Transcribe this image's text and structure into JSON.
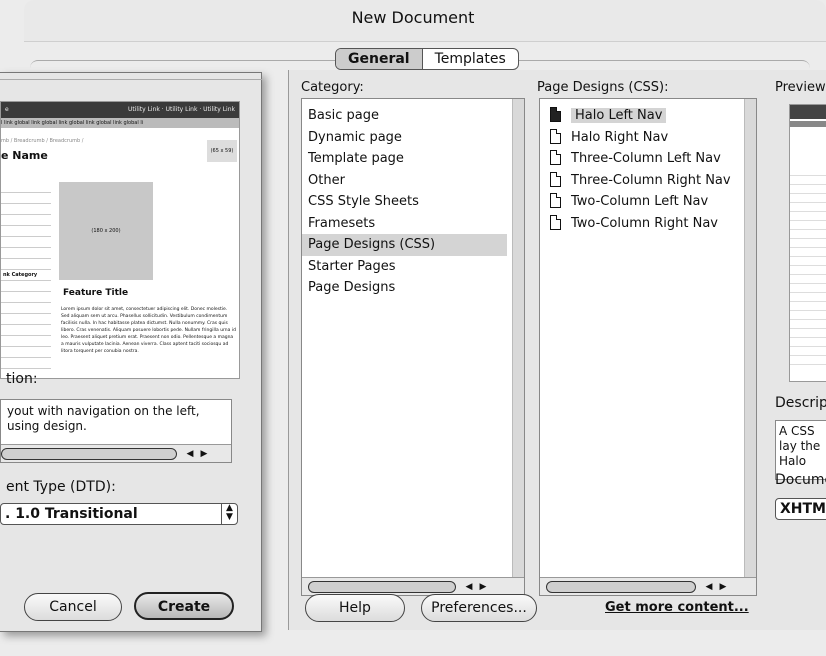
{
  "window": {
    "title": "New Document"
  },
  "tabs": [
    {
      "label": "General",
      "active": true
    },
    {
      "label": "Templates",
      "active": false
    }
  ],
  "category": {
    "header": "Category:",
    "items": [
      "Basic page",
      "Dynamic page",
      "Template page",
      "Other",
      "CSS Style Sheets",
      "Framesets",
      "Page Designs (CSS)",
      "Starter Pages",
      "Page Designs"
    ],
    "selected": "Page Designs (CSS)"
  },
  "page_designs": {
    "header": "Page Designs (CSS):",
    "items": [
      "Halo Left Nav",
      "Halo Right Nav",
      "Three-Column Left Nav",
      "Three-Column Right Nav",
      "Two-Column Left Nav",
      "Two-Column Right Nav"
    ],
    "selected": "Halo Left Nav"
  },
  "preview_right": {
    "header": "Preview:",
    "description_label": "Descript",
    "description_text": "A CSS lay the Halo",
    "doctype_label": "Docume",
    "doctype_value": "XHTMI"
  },
  "left_window": {
    "description_label": "tion:",
    "description_text": "yout with navigation on the left, using design.",
    "doctype_label": "ent Type (DTD):",
    "doctype_value": ". 1.0 Transitional",
    "buttons": {
      "cancel": "Cancel",
      "create": "Create"
    },
    "preview_thumb": {
      "site_name": "e",
      "utility": "Utility Link · Utility Link · Utility Link",
      "global": "l link  global link  global link  global link  global link  global li",
      "breadcrumb": "mb / Breadcrumb / Breadcrumb /",
      "page_name": "e Name",
      "badge": "(65 x 59)",
      "image_size": "(180 x 200)",
      "feature_title": "Feature Title",
      "nav_cat": "nk Category",
      "lorem": "Lorem ipsum dolor sit amet, consectetuer adipiscing elit. Donec molestie. Sed aliquam sem ut arcu. Phasellus sollicitudin. Vestibulum condimentum facilisis nulla. In hac habitasse platea dictumst. Nulla nonummy. Cras quis libero. Cras venenatis. Aliquam posuere lobortis pede. Nullam fringilla urna id leo. Praesent aliquet pretium erat. Praesent non odio. Pellentesque a magna a mauris vulputate lacinia. Aenean viverra. Class aptent taciti sociosqu ad litora torquent per conubia nostra."
    }
  },
  "bottom": {
    "help": "Help",
    "preferences": "Preferences...",
    "get_more": "Get more content..."
  }
}
